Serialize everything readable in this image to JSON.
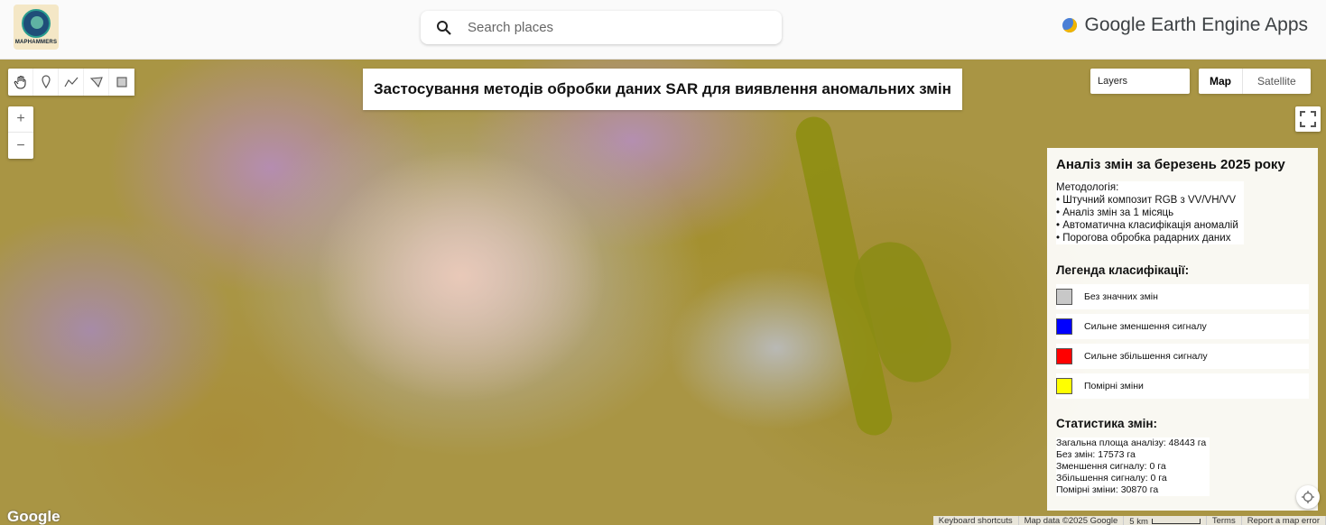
{
  "header": {
    "logo_text": "MAPHAMMERS",
    "search_placeholder": "Search places",
    "brand": "Google Earth Engine Apps"
  },
  "map": {
    "title": "Застосування методів обробки даних SAR для виявлення аномальних змін",
    "layers_label": "Layers",
    "maptype": {
      "map": "Map",
      "satellite": "Satellite"
    },
    "zoom": {
      "in": "+",
      "out": "−"
    },
    "google_logo": "Google",
    "attribution": {
      "shortcuts": "Keyboard shortcuts",
      "data": "Map data ©2025 Google",
      "scale": "5 km",
      "terms": "Terms",
      "report": "Report a map error"
    }
  },
  "panel": {
    "title": "Аналіз змін за березень 2025 року",
    "methodology_heading": "Методологія:",
    "methodology": [
      "• Штучний композит RGB з VV/VH/VV",
      "• Аналіз змін за 1 місяць",
      "• Автоматична класифікація аномалій",
      "• Порогова обробка радарних даних"
    ],
    "legend_heading": "Легенда класифікації:",
    "legend": [
      {
        "label": "Без значних змін",
        "color": "#c8c8c8"
      },
      {
        "label": "Сильне зменшення сигналу",
        "color": "#0000ff"
      },
      {
        "label": "Сильне збільшення сигналу",
        "color": "#ff0000"
      },
      {
        "label": "Помірні зміни",
        "color": "#ffff00"
      }
    ],
    "stats_heading": "Статистика змін:",
    "stats": [
      "Загальна площа аналізу: 48443 га",
      "Без змін: 17573 га",
      "Зменшення сигналу: 0 га",
      "Збільшення сигналу: 0 га",
      "Помірні зміни: 30870 га"
    ]
  }
}
